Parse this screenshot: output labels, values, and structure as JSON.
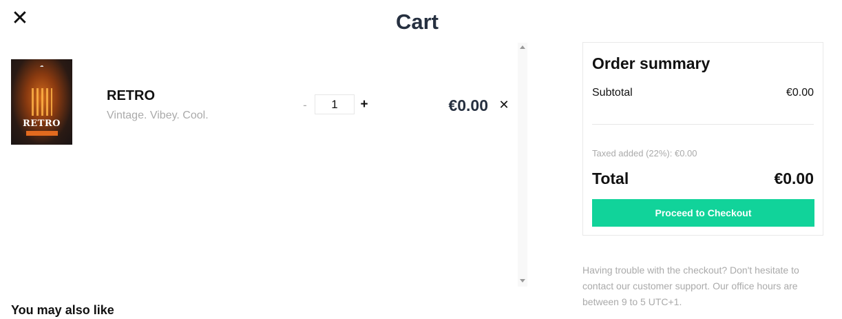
{
  "header": {
    "close_icon": "close-icon",
    "close_glyph": "✕",
    "title": "Cart"
  },
  "cart": {
    "items": [
      {
        "name": "RETRO",
        "description": "Vintage. Vibey. Cool.",
        "quantity": "1",
        "minus_label": "-",
        "plus_label": "+",
        "price": "€0.00",
        "remove_glyph": "✕",
        "thumbnail": {
          "word": "RETRO",
          "brand_glyph": "☁"
        }
      }
    ]
  },
  "summary": {
    "title": "Order summary",
    "subtotal_label": "Subtotal",
    "subtotal_value": "€0.00",
    "tax_note": "Taxed added (22%): €0.00",
    "total_label": "Total",
    "total_value": "€0.00",
    "checkout_label": "Proceed to Checkout"
  },
  "help_text": "Having trouble with the checkout? Don't hesitate to contact our customer support. Our office hours are between 9 to 5 UTC+1.",
  "upsell": {
    "heading": "You may also like"
  },
  "colors": {
    "accent": "#11d39a",
    "title": "#263040",
    "muted": "#aaaaaa"
  }
}
